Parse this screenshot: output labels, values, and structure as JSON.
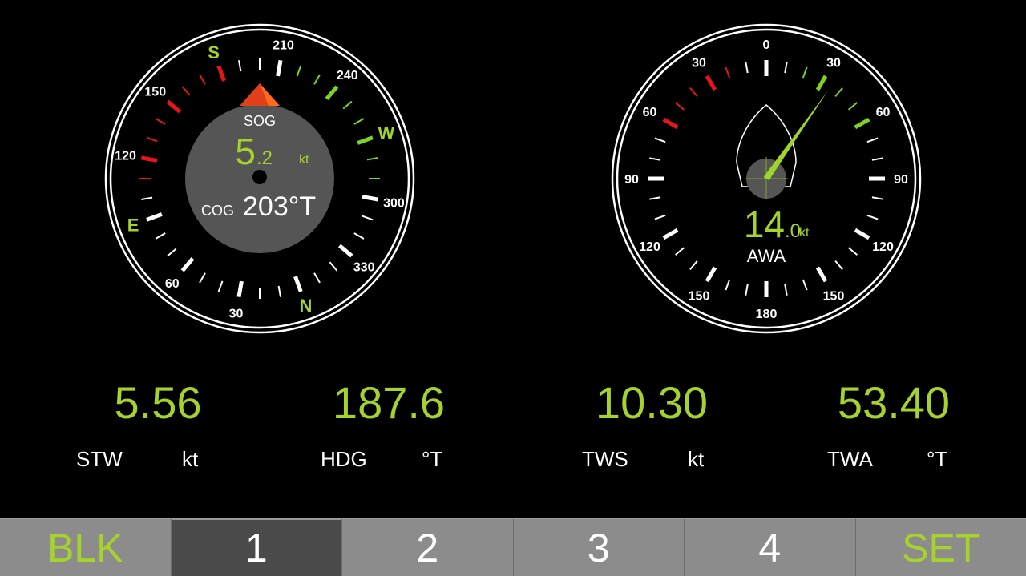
{
  "colors": {
    "accent_green": "#a6d22c",
    "port_red": "#e8141a",
    "starboard_green": "#7ed321",
    "marker_red": "#e0401a",
    "hub_gray": "#555555",
    "background": "#000000"
  },
  "compass": {
    "rotation_deg": 200,
    "cardinals": [
      {
        "label": "S",
        "bearing": 180
      },
      {
        "label": "W",
        "bearing": 270
      },
      {
        "label": "N",
        "bearing": 0
      },
      {
        "label": "E",
        "bearing": 90
      }
    ],
    "numbers": [
      {
        "label": "210",
        "bearing": 210
      },
      {
        "label": "240",
        "bearing": 240
      },
      {
        "label": "300",
        "bearing": 300
      },
      {
        "label": "330",
        "bearing": 330
      },
      {
        "label": "30",
        "bearing": 30
      },
      {
        "label": "60",
        "bearing": 60
      },
      {
        "label": "120",
        "bearing": 120
      },
      {
        "label": "150",
        "bearing": 150
      }
    ],
    "sog_label": "SOG",
    "sog_whole": "5",
    "sog_fraction": ".2",
    "sog_unit": "kt",
    "cog_label": "COG",
    "cog_value": "203°T"
  },
  "wind": {
    "awa_deg": 35,
    "numbers": [
      {
        "label": "0",
        "angle": 0
      },
      {
        "label": "30",
        "angle": 30
      },
      {
        "label": "60",
        "angle": 60
      },
      {
        "label": "90",
        "angle": 90
      },
      {
        "label": "120",
        "angle": 120
      },
      {
        "label": "150",
        "angle": 150
      },
      {
        "label": "180",
        "angle": 180
      },
      {
        "label": "150",
        "angle": 210
      },
      {
        "label": "120",
        "angle": 240
      },
      {
        "label": "90",
        "angle": 270
      },
      {
        "label": "60",
        "angle": 300
      },
      {
        "label": "30",
        "angle": 330
      }
    ],
    "speed_whole": "14",
    "speed_fraction": ".0",
    "speed_unit": "kt",
    "label": "AWA"
  },
  "readouts": {
    "stw": {
      "value": "5.56",
      "label": "STW",
      "unit": "kt"
    },
    "hdg": {
      "value": "187.6",
      "label": "HDG",
      "unit": "°T"
    },
    "tws": {
      "value": "10.30",
      "label": "TWS",
      "unit": "kt"
    },
    "twa": {
      "value": "53.40",
      "label": "TWA",
      "unit": "°T"
    }
  },
  "bottom_bar": {
    "blk": "BLK",
    "page1": "1",
    "page2": "2",
    "page3": "3",
    "page4": "4",
    "set": "SET"
  }
}
